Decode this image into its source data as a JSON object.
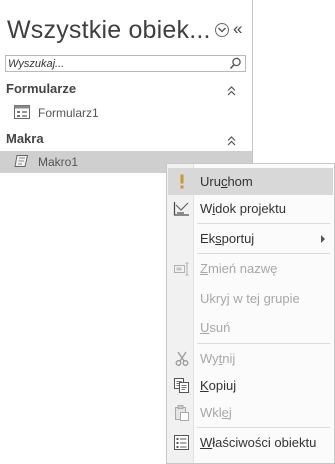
{
  "nav": {
    "title": "Wszystkie obiek...",
    "search_placeholder": "Wyszukaj...",
    "groups": [
      {
        "label": "Formularze",
        "items": [
          {
            "label": "Formularz1",
            "icon": "form-icon"
          }
        ]
      },
      {
        "label": "Makra",
        "items": [
          {
            "label": "Makro1",
            "icon": "macro-icon",
            "selected": true
          }
        ]
      }
    ]
  },
  "context_menu": {
    "items": [
      {
        "pre": "Uru",
        "key": "c",
        "post": "hom",
        "icon": "run-icon",
        "enabled": true,
        "hover": true
      },
      {
        "pre": "W",
        "key": "i",
        "post": "dok projektu",
        "icon": "design-view-icon",
        "enabled": true
      },
      {
        "pre": "Ek",
        "key": "s",
        "post": "portuj",
        "icon": "",
        "enabled": true,
        "submenu": true
      },
      {
        "pre": "",
        "key": "Z",
        "post": "mień nazwę",
        "icon": "rename-icon",
        "enabled": false
      },
      {
        "pre": "Ukryj w tej ",
        "key": "g",
        "post": "rupie",
        "icon": "",
        "enabled": false
      },
      {
        "pre": "",
        "key": "U",
        "post": "suń",
        "icon": "",
        "enabled": false
      },
      {
        "pre": "Wy",
        "key": "t",
        "post": "nij",
        "icon": "cut-icon",
        "enabled": false
      },
      {
        "pre": "",
        "key": "K",
        "post": "opiuj",
        "icon": "copy-icon",
        "enabled": true
      },
      {
        "pre": "Wkl",
        "key": "e",
        "post": "j",
        "icon": "paste-icon",
        "enabled": false
      },
      {
        "pre": "",
        "key": "W",
        "post": "łaściwości obiektu",
        "icon": "properties-icon",
        "enabled": true
      }
    ]
  },
  "colors": {
    "selected_row": "#cfcfcf",
    "menu_hover": "#d8d8d8",
    "disabled_text": "#a8a8a8",
    "run_icon": "#c89a2a"
  }
}
